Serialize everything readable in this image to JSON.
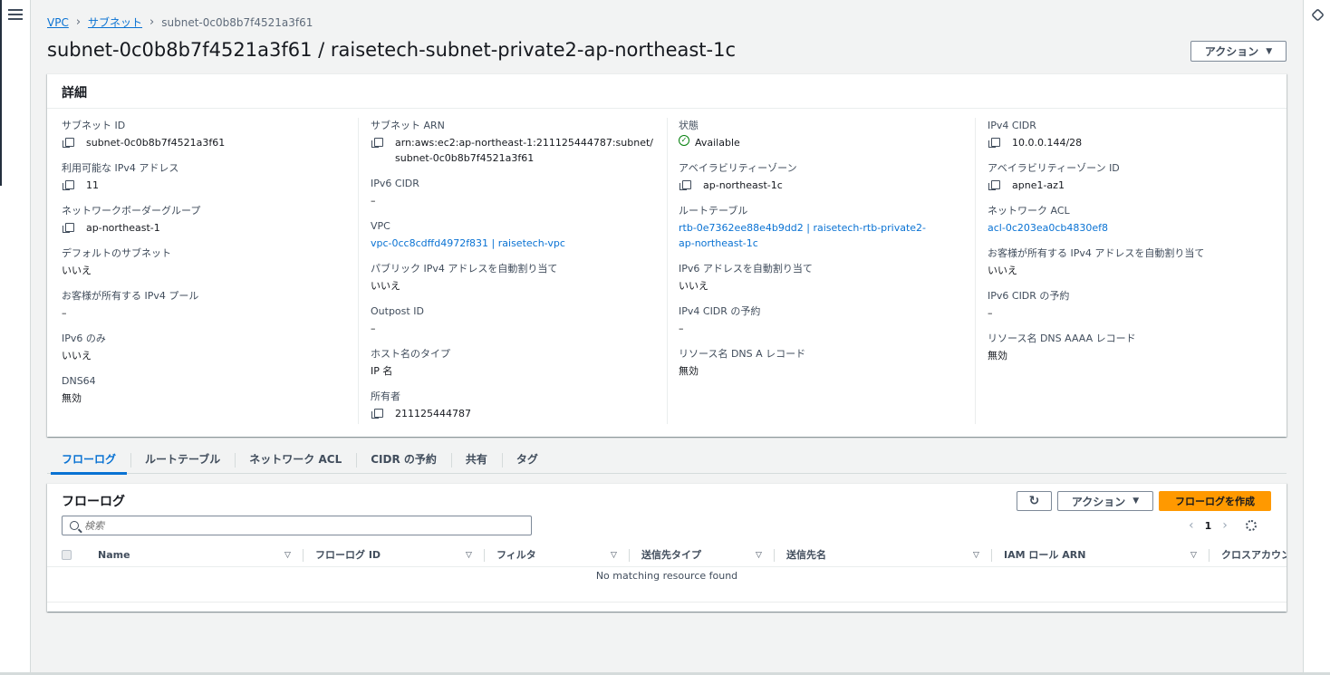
{
  "breadcrumb": {
    "vpc": "VPC",
    "subnets": "サブネット",
    "current": "subnet-0c0b8b7f4521a3f61"
  },
  "page_title": "subnet-0c0b8b7f4521a3f61 / raisetech-subnet-private2-ap-northeast-1c",
  "header_action_label": "アクション",
  "details": {
    "title": "詳細",
    "col1": [
      {
        "label": "サブネット ID",
        "value": "subnet-0c0b8b7f4521a3f61"
      },
      {
        "label": "利用可能な IPv4 アドレス",
        "value": "11"
      },
      {
        "label": "ネットワークボーダーグループ",
        "value": "ap-northeast-1"
      },
      {
        "label": "デフォルトのサブネット",
        "value": "いいえ"
      },
      {
        "label": "お客様が所有する IPv4 プール",
        "value": "–"
      },
      {
        "label": "IPv6 のみ",
        "value": "いいえ"
      },
      {
        "label": "DNS64",
        "value": "無効"
      }
    ],
    "col2": [
      {
        "label": "サブネット ARN",
        "value": "arn:aws:ec2:ap-northeast-1:211125444787:subnet/subnet-0c0b8b7f4521a3f61"
      },
      {
        "label": "IPv6 CIDR",
        "value": "–"
      },
      {
        "label": "VPC",
        "value": "vpc-0cc8cdffd4972f831 | raisetech-vpc"
      },
      {
        "label": "パブリック IPv4 アドレスを自動割り当て",
        "value": "いいえ"
      },
      {
        "label": "Outpost ID",
        "value": "–"
      },
      {
        "label": "ホスト名のタイプ",
        "value": "IP 名"
      },
      {
        "label": "所有者",
        "value": "211125444787"
      }
    ],
    "col3": [
      {
        "label": "状態",
        "value": "Available"
      },
      {
        "label": "アベイラビリティーゾーン",
        "value": "ap-northeast-1c"
      },
      {
        "label": "ルートテーブル",
        "value": "rtb-0e7362ee88e4b9dd2 | raisetech-rtb-private2-ap-northeast-1c"
      },
      {
        "label": "IPv6 アドレスを自動割り当て",
        "value": "いいえ"
      },
      {
        "label": "IPv4 CIDR の予約",
        "value": "–"
      },
      {
        "label": "リソース名 DNS A レコード",
        "value": "無効"
      }
    ],
    "col4": [
      {
        "label": "IPv4 CIDR",
        "value": "10.0.0.144/28"
      },
      {
        "label": "アベイラビリティーゾーン ID",
        "value": "apne1-az1"
      },
      {
        "label": "ネットワーク ACL",
        "value": "acl-0c203ea0cb4830ef8"
      },
      {
        "label": "お客様が所有する IPv4 アドレスを自動割り当て",
        "value": "いいえ"
      },
      {
        "label": "IPv6 CIDR の予約",
        "value": "–"
      },
      {
        "label": "リソース名 DNS AAAA レコード",
        "value": "無効"
      }
    ]
  },
  "tabs": [
    "フローログ",
    "ルートテーブル",
    "ネットワーク ACL",
    "CIDR の予約",
    "共有",
    "タグ"
  ],
  "flowlogs": {
    "title": "フローログ",
    "action_label": "アクション",
    "create_label": "フローログを作成",
    "search_placeholder": "検索",
    "page": "1",
    "columns": [
      "Name",
      "フローログ ID",
      "フィルタ",
      "送信先タイプ",
      "送信先名",
      "IAM ロール ARN",
      "クロスアカウン"
    ],
    "empty_text": "No matching resource found"
  },
  "colors": {
    "link": "#0972d3",
    "primary": "#ff9900",
    "success": "#037f0c"
  }
}
